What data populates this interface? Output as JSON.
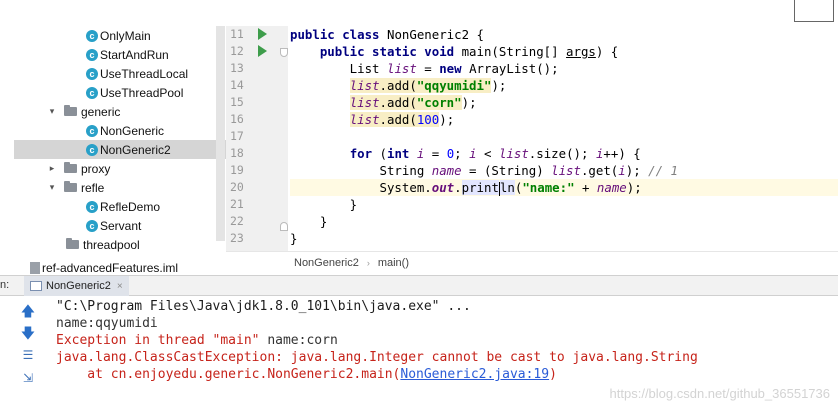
{
  "tree": {
    "items": [
      {
        "label": "OnlyMain",
        "kind": "class"
      },
      {
        "label": "StartAndRun",
        "kind": "class"
      },
      {
        "label": "UseThreadLocal",
        "kind": "class"
      },
      {
        "label": "UseThreadPool",
        "kind": "class"
      },
      {
        "label": "generic",
        "kind": "package"
      },
      {
        "label": "NonGeneric",
        "kind": "class"
      },
      {
        "label": "NonGeneric2",
        "kind": "class"
      },
      {
        "label": "proxy",
        "kind": "package"
      },
      {
        "label": "refle",
        "kind": "package"
      },
      {
        "label": "RefleDemo",
        "kind": "class"
      },
      {
        "label": "Servant",
        "kind": "class"
      },
      {
        "label": "threadpool",
        "kind": "package"
      }
    ],
    "iml_file": "ref-advancedFeatures.iml",
    "class_badge": "c",
    "expand_glyph": "▾",
    "collapse_glyph": "▸"
  },
  "editor": {
    "line_numbers": [
      "11",
      "12",
      "13",
      "14",
      "15",
      "16",
      "17",
      "18",
      "19",
      "20",
      "21",
      "22",
      "23"
    ]
  },
  "breadcrumb": {
    "class_name": "NonGeneric2",
    "separator": "›",
    "method": "main()"
  },
  "run_panel": {
    "prefix": "n:",
    "tab_label": "NonGeneric2",
    "close_glyph": "×",
    "console": [
      {
        "text": "\"C:\\Program Files\\Java\\jdk1.8.0_101\\bin\\java.exe\" ...",
        "style": "cmd"
      },
      {
        "text": "name:qqyumidi",
        "style": "plain"
      },
      {
        "text_red": "Exception in thread \"main\" ",
        "text_plain": "name:corn"
      },
      {
        "text": "java.lang.ClassCastException: java.lang.Integer cannot be cast to java.lang.String",
        "style": "red"
      },
      {
        "prefix": "    at cn.enjoyedu.generic.NonGeneric2.main(",
        "link": "NonGeneric2.java:19",
        "suffix": ")"
      }
    ],
    "toolbar_icons": [
      "up-arrow-icon",
      "down-arrow-icon",
      "soft-wrap-icon",
      "scroll-to-end-icon"
    ]
  },
  "watermark": "https://blog.csdn.net/github_36551736"
}
